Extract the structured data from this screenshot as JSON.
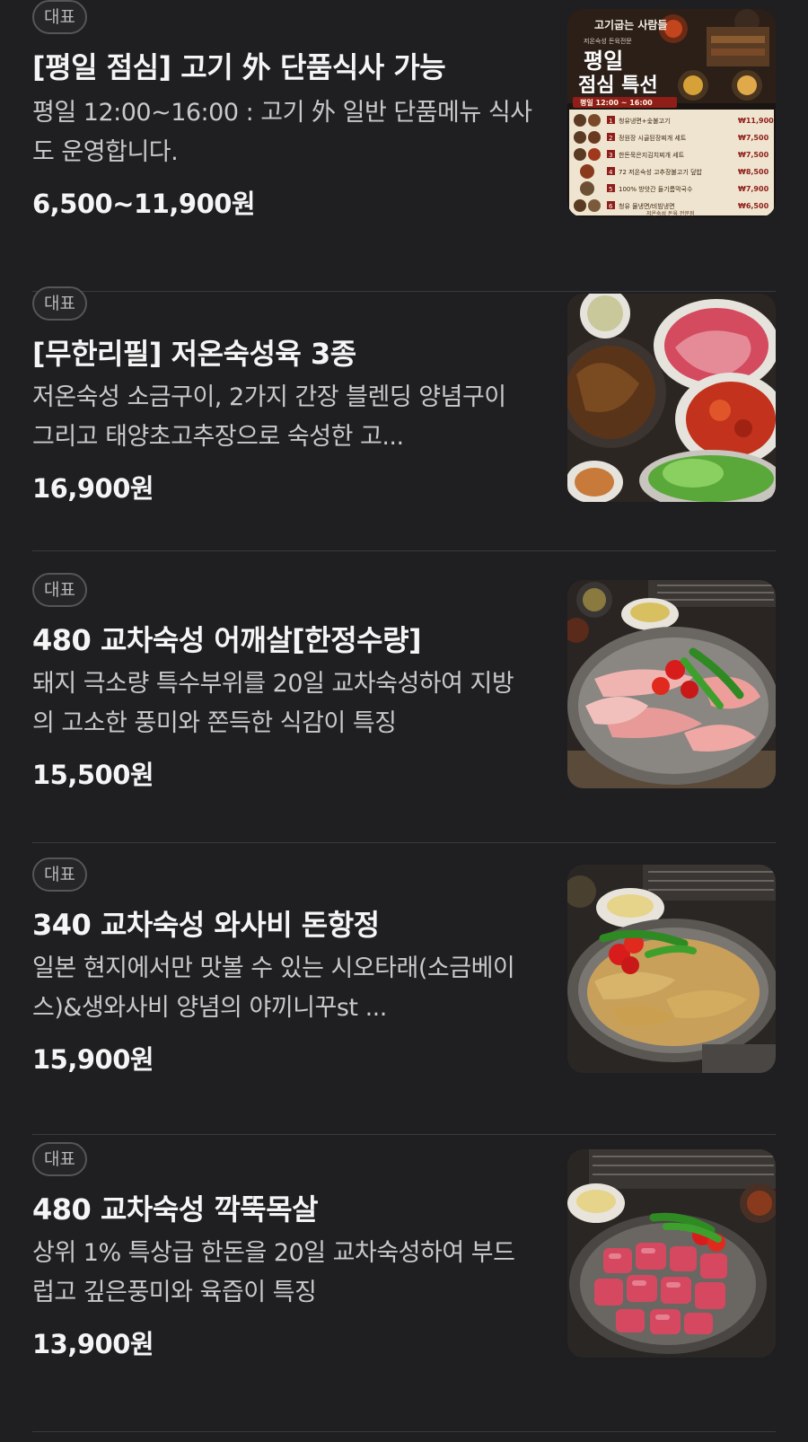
{
  "badge_label": "대표",
  "items": [
    {
      "title": "[평일 점심] 고기 外 단품식사 가능",
      "description": "평일 12:00~16:00 : 고기 外 일반 단품메뉴 식사도 운영합니다.",
      "price": "6,500~11,900원",
      "image": "lunch-special-menu-poster"
    },
    {
      "title": "[무한리필] 저온숙성육 3종",
      "description": "저온숙성 소금구이, 2가지 간장 블렌딩 양념구이 그리고 태양초고추장으로 숙성한 고...",
      "price": "16,900원",
      "image": "three-aged-meats-platter-photo"
    },
    {
      "title": "480 교차숙성 어깨살[한정수량]",
      "description": "돼지 극소량 특수부위를 20일 교차숙성하여 지방의 고소한 풍미와 쫀득한 식감이 특징",
      "price": "15,500원",
      "image": "pork-shoulder-grill-photo"
    },
    {
      "title": "340 교차숙성 와사비 돈항정",
      "description": "일본 현지에서만 맛볼 수 있는 시오타래(소금베이스)&생와사비 양념의 야끼니꾸st ...",
      "price": "15,900원",
      "image": "wasabi-pork-jowl-photo"
    },
    {
      "title": "480 교차숙성 깍뚝목살",
      "description": "상위 1% 특상급 한돈을 20일 교차숙성하여 부드럽고 깊은풍미와 육즙이 특징",
      "price": "13,900원",
      "image": "cubed-pork-neck-photo"
    }
  ],
  "poster": {
    "brand": "고기굽는 사람들",
    "subtitle": "저온숙성 돈육전문",
    "headline_1": "평일",
    "headline_2": "점심 특선",
    "hours": "평일 12:00 ~ 16:00",
    "menu": [
      {
        "num": "1",
        "name": "청유냉면+숯불고기",
        "price": "₩11,900"
      },
      {
        "num": "2",
        "name": "정원장 시골된장찌개 세트",
        "price": "₩7,500"
      },
      {
        "num": "3",
        "name": "한돈묵은지김치찌개 세트",
        "price": "₩7,500"
      },
      {
        "num": "4",
        "name": "72 저온숙성 고추장불고기 덮밥",
        "price": "₩8,500"
      },
      {
        "num": "5",
        "name": "100% 방앗간 들기름막국수",
        "price": "₩7,900"
      },
      {
        "num": "6",
        "name": "청유 물냉면/비빔냉면",
        "price": "₩6,500"
      }
    ],
    "footer": "저온숙성 돈육 전문점"
  },
  "colors": {
    "background": "#1f1f21",
    "text": "#f5f5f5",
    "muted": "#c9c9cc",
    "badge_border": "#55555a",
    "divider": "#3a3a3d"
  }
}
